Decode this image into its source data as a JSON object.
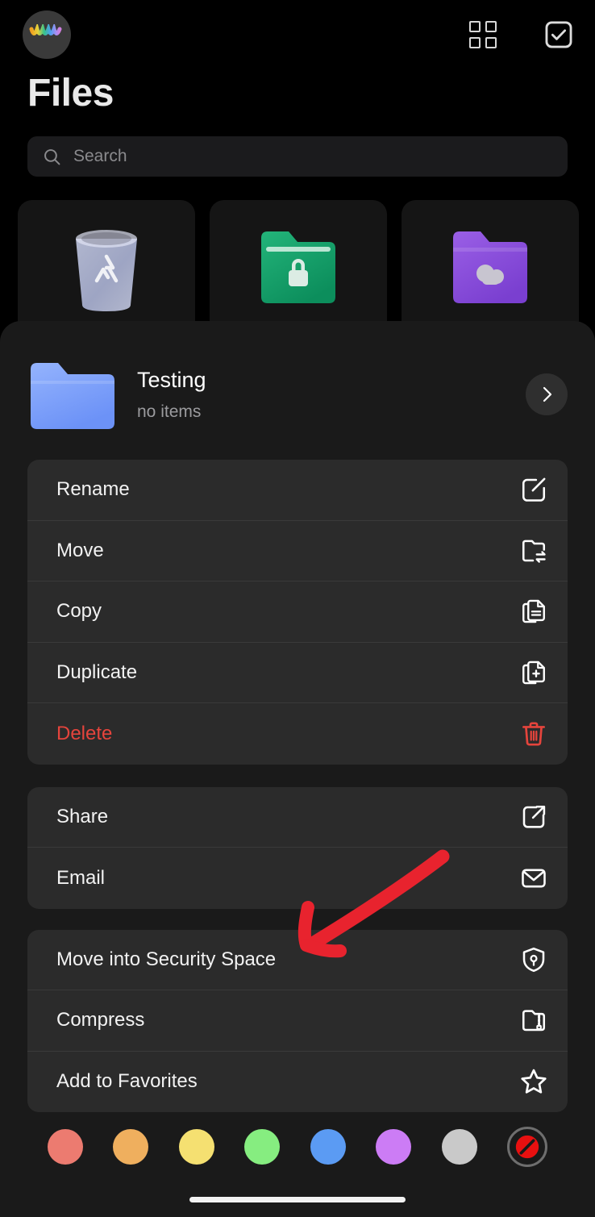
{
  "app": {
    "title": "Files",
    "background_color": "#000000",
    "sheet_color": "#1a1a1a",
    "accent_danger": "#e5443c",
    "annotation_color": "#e8232e"
  },
  "topbar": {
    "avatar_name": "user-avatar",
    "grid_view_label": "grid-view",
    "select_label": "select-mode"
  },
  "search": {
    "placeholder": "Search",
    "value": "",
    "icon": "search-icon"
  },
  "quick_cards": [
    {
      "name": "recycle-bin",
      "icon": "trash-bin-icon",
      "color": "#b9bee0"
    },
    {
      "name": "security-space",
      "icon": "locked-folder-icon",
      "color": "#16a06a"
    },
    {
      "name": "cloud-folder",
      "icon": "cloud-folder-icon",
      "color": "#8a4fd8"
    }
  ],
  "sheet": {
    "item_icon": "blue-folder-icon",
    "item_color": "#7ea3fb",
    "title": "Testing",
    "subtitle": "no items",
    "open_button": "chevron-right-icon",
    "groups": [
      {
        "name": "file-operations",
        "rows": [
          {
            "label": "Rename",
            "icon": "edit-square-icon",
            "danger": false
          },
          {
            "label": "Move",
            "icon": "folder-move-icon",
            "danger": false
          },
          {
            "label": "Copy",
            "icon": "copy-icon",
            "danger": false
          },
          {
            "label": "Duplicate",
            "icon": "duplicate-icon",
            "danger": false
          },
          {
            "label": "Delete",
            "icon": "trash-icon",
            "danger": true
          }
        ]
      },
      {
        "name": "sharing",
        "rows": [
          {
            "label": "Share",
            "icon": "share-icon",
            "danger": false
          },
          {
            "label": "Email",
            "icon": "mail-icon",
            "danger": false
          }
        ]
      },
      {
        "name": "advanced",
        "rows": [
          {
            "label": "Move into Security Space",
            "icon": "shield-lock-icon",
            "danger": false
          },
          {
            "label": "Compress",
            "icon": "folder-zip-icon",
            "danger": false
          },
          {
            "label": "Add to Favorites",
            "icon": "star-icon",
            "danger": false
          }
        ]
      }
    ]
  },
  "color_tags": [
    {
      "name": "red",
      "color": "#ec7b70"
    },
    {
      "name": "orange",
      "color": "#efaf5e"
    },
    {
      "name": "yellow",
      "color": "#f5e071"
    },
    {
      "name": "green",
      "color": "#86ed80"
    },
    {
      "name": "blue",
      "color": "#5b9bf3"
    },
    {
      "name": "purple",
      "color": "#cc7cf5"
    },
    {
      "name": "gray",
      "color": "#c9c9c9"
    },
    {
      "name": "none",
      "color": "#e81010"
    }
  ],
  "annotation": {
    "type": "arrow",
    "points_to": "Move into Security Space",
    "color": "#e8232e"
  },
  "home_indicator": "home-indicator"
}
